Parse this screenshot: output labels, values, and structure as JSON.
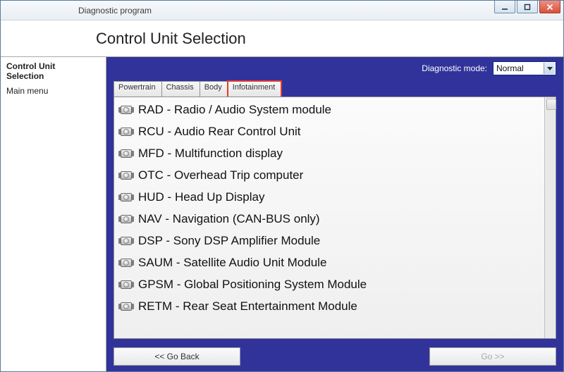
{
  "window": {
    "title": "Diagnostic program"
  },
  "header": {
    "page_title": "Control Unit Selection"
  },
  "sidebar": {
    "crumb_line1": "Control Unit",
    "crumb_line2": "Selection",
    "main_menu": "Main menu"
  },
  "diagnostic_mode": {
    "label": "Diagnostic mode:",
    "value": "Normal"
  },
  "tabs": [
    {
      "label": "Powertrain",
      "active": false
    },
    {
      "label": "Chassis",
      "active": false
    },
    {
      "label": "Body",
      "active": false
    },
    {
      "label": "Infotainment",
      "active": true
    }
  ],
  "modules": [
    {
      "code": "RAD",
      "name": "Radio / Audio System module"
    },
    {
      "code": "RCU",
      "name": "Audio Rear Control Unit"
    },
    {
      "code": "MFD",
      "name": "Multifunction display"
    },
    {
      "code": "OTC",
      "name": "Overhead Trip computer"
    },
    {
      "code": "HUD",
      "name": "Head Up Display"
    },
    {
      "code": "NAV",
      "name": "Navigation (CAN-BUS only)"
    },
    {
      "code": "DSP",
      "name": "Sony DSP Amplifier Module"
    },
    {
      "code": "SAUM",
      "name": "Satellite Audio Unit Module"
    },
    {
      "code": "GPSM",
      "name": "Global Positioning System Module"
    },
    {
      "code": "RETM",
      "name": "Rear Seat Entertainment Module"
    }
  ],
  "footer": {
    "back": "<< Go Back",
    "go": "Go >>"
  }
}
